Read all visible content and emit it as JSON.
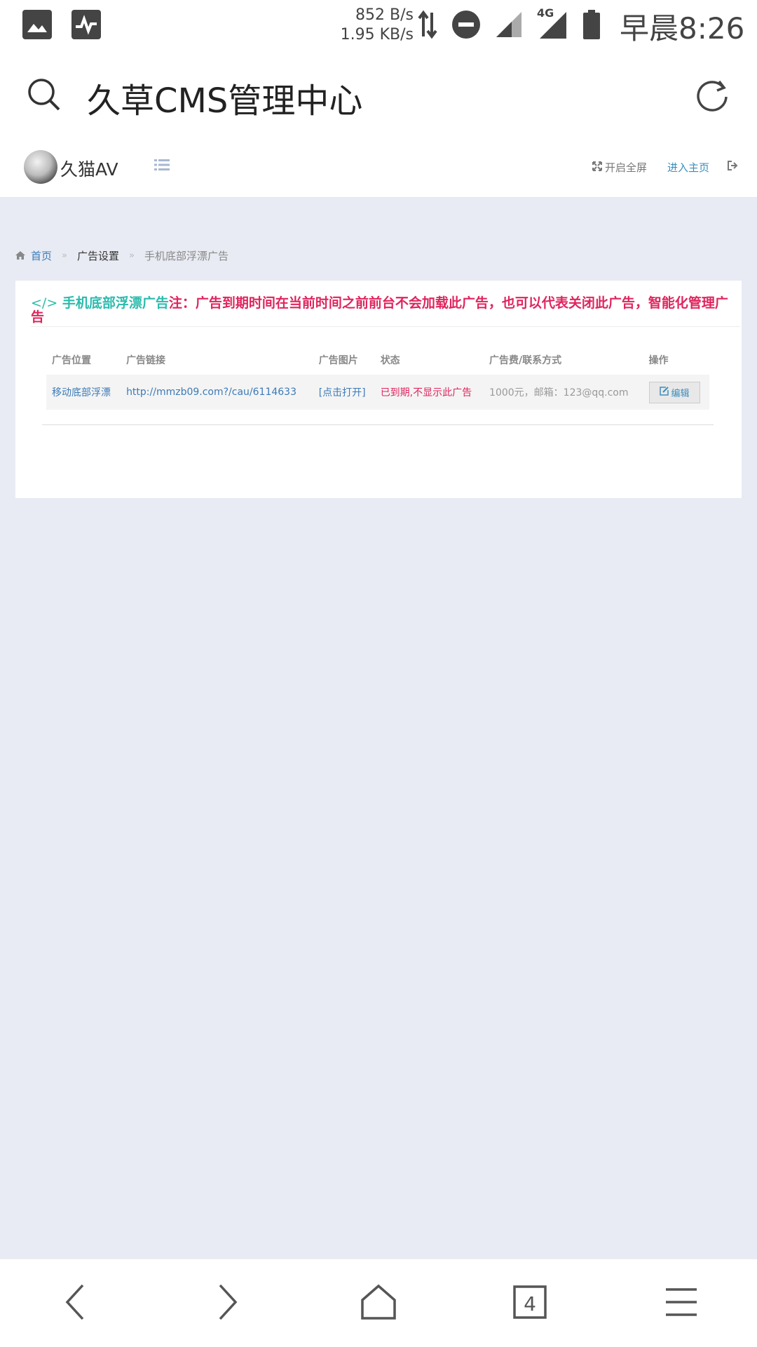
{
  "statusbar": {
    "net_up": "852 B/s",
    "net_down": "1.95 KB/s",
    "network_type": "4G",
    "time": "早晨8:26",
    "icons": [
      "image-icon",
      "activity-icon",
      "data-arrows-icon",
      "dnd-icon",
      "signal-icon",
      "signal-4g-icon",
      "battery-icon"
    ]
  },
  "titlebar": {
    "title": "久草CMS管理中心"
  },
  "header": {
    "brand": "久猫AV",
    "fullscreen": "开启全屏",
    "home": "进入主页"
  },
  "breadcrumb": {
    "home": "首页",
    "section": "广告设置",
    "current": "手机底部浮漂广告",
    "separator": "»"
  },
  "panel": {
    "icon": "</>",
    "name": "手机底部浮漂广告",
    "note": "注：广告到期时间在当前时间之前前台不会加载此广告，也可以代表关闭此广告，智能化管理广告"
  },
  "table": {
    "headers": [
      "广告位置",
      "广告链接",
      "广告图片",
      "状态",
      "广告费/联系方式",
      "操作"
    ],
    "rows": [
      {
        "position": "移动底部浮漂",
        "link": "http://mmzb09.com?/cau/6114633",
        "image": "[点击打开]",
        "status": "已到期,不显示此广告",
        "fee": "1000元，邮箱：123@qq.com",
        "action": "编辑"
      }
    ]
  },
  "navbar": {
    "tab_count": "4"
  },
  "colors": {
    "accent": "#3c8dbc",
    "teal": "#2bbbad",
    "alert": "#e0245e",
    "page_bg": "#e8ebf3"
  }
}
